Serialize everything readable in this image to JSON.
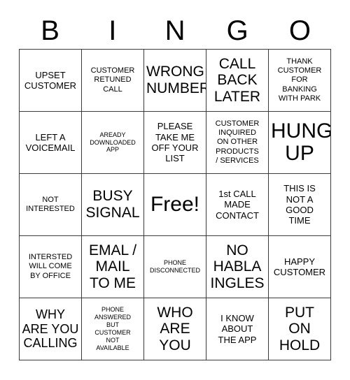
{
  "card": {
    "title_letters": [
      "B",
      "I",
      "N",
      "G",
      "O"
    ],
    "colors": {
      "background": "#ffffff",
      "border": "#3a3a3a",
      "text": "#000000"
    },
    "grid": {
      "rows": 5,
      "columns": 5,
      "cells": [
        {
          "text": "UPSET\nCUSTOMER",
          "size": "fs-sm"
        },
        {
          "text": "CUSTOMER\nRETUNED\nCALL",
          "size": "fs-xs"
        },
        {
          "text": "WRONG\nNUMBER",
          "size": "fs-lg"
        },
        {
          "text": "CALL\nBACK\nLATER",
          "size": "fs-lg"
        },
        {
          "text": "THANK\nCUSTOMER\nFOR\nBANKING\nWITH PARK",
          "size": "fs-xs"
        },
        {
          "text": "LEFT A\nVOICEMAIL",
          "size": "fs-sm"
        },
        {
          "text": "AREADY\nDOWNLOADED\nAPP",
          "size": "fs-xxs"
        },
        {
          "text": "PLEASE\nTAKE ME\nOFF YOUR\nLIST",
          "size": "fs-sm"
        },
        {
          "text": "CUSTOMER\nINQUIRED\nON OTHER\nPRODUCTS\n/ SERVICES",
          "size": "fs-xs"
        },
        {
          "text": "HUNG\nUP",
          "size": "fs-xl"
        },
        {
          "text": "NOT\nINTERESTED",
          "size": "fs-xs"
        },
        {
          "text": "BUSY\nSIGNAL",
          "size": "fs-lg"
        },
        {
          "text": "Free!",
          "size": "free"
        },
        {
          "text": "1st CALL\nMADE\nCONTACT",
          "size": "fs-sm"
        },
        {
          "text": "THIS IS\nNOT A\nGOOD\nTIME",
          "size": "fs-sm"
        },
        {
          "text": "INTERSTED\nWILL COME\nBY OFFICE",
          "size": "fs-xs"
        },
        {
          "text": "EMAL /\nMAIL\nTO ME",
          "size": "fs-lg"
        },
        {
          "text": "PHONE\nDISCONNECTED",
          "size": "fs-xxs"
        },
        {
          "text": "NO\nHABLA\nINGLES",
          "size": "fs-lg"
        },
        {
          "text": "HAPPY\nCUSTOMER",
          "size": "fs-sm"
        },
        {
          "text": "WHY\nARE YOU\nCALLING",
          "size": "fs-md"
        },
        {
          "text": "PHONE\nANSWERED\nBUT\nCUSTOMER\nNOT\nAVAILABLE",
          "size": "fs-xxs"
        },
        {
          "text": "WHO\nARE\nYOU",
          "size": "fs-lg"
        },
        {
          "text": "I KNOW\nABOUT\nTHE APP",
          "size": "fs-sm"
        },
        {
          "text": "PUT\nON\nHOLD",
          "size": "fs-lg"
        }
      ]
    }
  }
}
